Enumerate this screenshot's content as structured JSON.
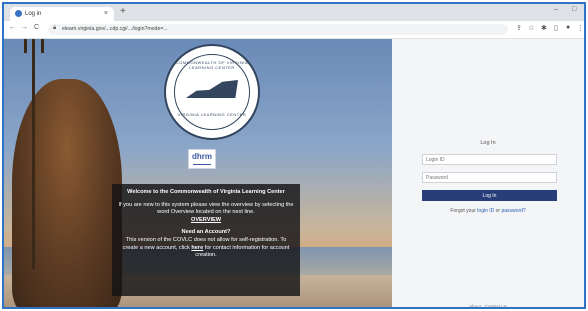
{
  "browser": {
    "tab_title": "Log in",
    "tab_close": "×",
    "new_tab": "+",
    "url": "elearn.virginia.gov/...cdp.cgi/.../login?mode=...",
    "window_controls": [
      "–",
      "□"
    ],
    "nav": [
      "←",
      "→",
      "C"
    ]
  },
  "seal": {
    "top_text": "COMMONWEALTH OF VIRGINIA LEARNING CENTER",
    "bottom_text": "VIRGINIA LEARNING CENTER"
  },
  "logo": {
    "text": "dhrm"
  },
  "info": {
    "heading": "Welcome to the Commonwealth of Virginia Learning Center",
    "overview_text": "If you are new to this system please view the overview by selecting the word Overview located on the next line.",
    "overview_link": "OVERVIEW",
    "need_account": "Need an Account?",
    "account_text_1": "This version of the COVLC does not allow for self-registration. To create a new account, click",
    "account_link": "here",
    "account_text_2": "for contact information for account creation."
  },
  "login": {
    "title": "Log In",
    "login_id_placeholder": "Login ID",
    "password_placeholder": "Password",
    "button": "Log In",
    "forgot_prefix": "Forgot your",
    "forgot_login": "login ID",
    "forgot_or": "or",
    "forgot_password": "password?"
  },
  "footer": {
    "about": "About",
    "contact": "Contact Us"
  },
  "colors": {
    "browser_border": "#2f73c7",
    "login_button": "#283e7a",
    "link": "#2b5db8",
    "info_panel": "#141416"
  }
}
